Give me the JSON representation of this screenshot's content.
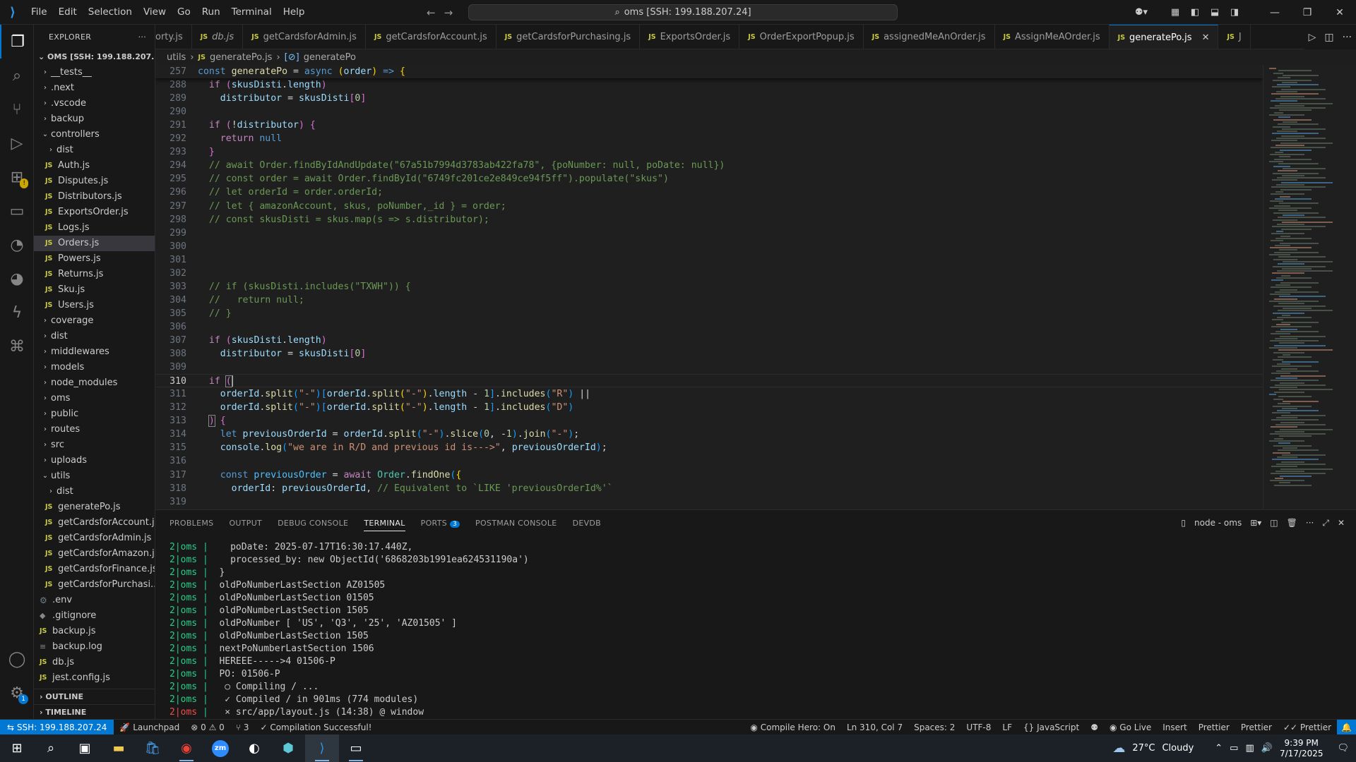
{
  "titlebar": {
    "menu": [
      "File",
      "Edit",
      "Selection",
      "View",
      "Go",
      "Run",
      "Terminal",
      "Help"
    ],
    "search_text": "oms [SSH: 199.188.207.24]"
  },
  "activity_bar": {
    "items": [
      "explorer-icon",
      "search-icon",
      "source-control-icon",
      "run-debug-icon",
      "extensions-icon",
      "remote-explorer-icon",
      "git-graph-icon",
      "thunder-client-icon",
      "lightning-icon",
      "python-icon"
    ],
    "bottom": [
      "account-icon",
      "settings-icon"
    ],
    "settings_badge": "1"
  },
  "explorer": {
    "title": "EXPLORER",
    "root": "OMS [SSH: 199.188.207.24]",
    "items": [
      {
        "label": "__tests__",
        "type": "folder",
        "depth": 1,
        "open": false
      },
      {
        "label": ".next",
        "type": "folder",
        "depth": 1,
        "open": false
      },
      {
        "label": ".vscode",
        "type": "folder",
        "depth": 1,
        "open": false
      },
      {
        "label": "backup",
        "type": "folder",
        "depth": 1,
        "open": false
      },
      {
        "label": "controllers",
        "type": "folder",
        "depth": 1,
        "open": true
      },
      {
        "label": "dist",
        "type": "folder",
        "depth": 2,
        "open": false
      },
      {
        "label": "Auth.js",
        "type": "js",
        "depth": 2
      },
      {
        "label": "Disputes.js",
        "type": "js",
        "depth": 2
      },
      {
        "label": "Distributors.js",
        "type": "js",
        "depth": 2
      },
      {
        "label": "ExportsOrder.js",
        "type": "js",
        "depth": 2
      },
      {
        "label": "Logs.js",
        "type": "js",
        "depth": 2
      },
      {
        "label": "Orders.js",
        "type": "js",
        "depth": 2,
        "selected": true
      },
      {
        "label": "Powers.js",
        "type": "js",
        "depth": 2
      },
      {
        "label": "Returns.js",
        "type": "js",
        "depth": 2
      },
      {
        "label": "Sku.js",
        "type": "js",
        "depth": 2
      },
      {
        "label": "Users.js",
        "type": "js",
        "depth": 2
      },
      {
        "label": "coverage",
        "type": "folder",
        "depth": 1,
        "open": false
      },
      {
        "label": "dist",
        "type": "folder",
        "depth": 1,
        "open": false
      },
      {
        "label": "middlewares",
        "type": "folder",
        "depth": 1,
        "open": false
      },
      {
        "label": "models",
        "type": "folder",
        "depth": 1,
        "open": false
      },
      {
        "label": "node_modules",
        "type": "folder",
        "depth": 1,
        "open": false
      },
      {
        "label": "oms",
        "type": "folder",
        "depth": 1,
        "open": false
      },
      {
        "label": "public",
        "type": "folder",
        "depth": 1,
        "open": false
      },
      {
        "label": "routes",
        "type": "folder",
        "depth": 1,
        "open": false
      },
      {
        "label": "src",
        "type": "folder",
        "depth": 1,
        "open": false
      },
      {
        "label": "uploads",
        "type": "folder",
        "depth": 1,
        "open": false
      },
      {
        "label": "utils",
        "type": "folder",
        "depth": 1,
        "open": true
      },
      {
        "label": "dist",
        "type": "folder",
        "depth": 2,
        "open": false
      },
      {
        "label": "generatePo.js",
        "type": "js",
        "depth": 2
      },
      {
        "label": "getCardsforAccount.js",
        "type": "js",
        "depth": 2
      },
      {
        "label": "getCardsforAdmin.js",
        "type": "js",
        "depth": 2
      },
      {
        "label": "getCardsforAmazon.js",
        "type": "js",
        "depth": 2
      },
      {
        "label": "getCardsforFinance.js",
        "type": "js",
        "depth": 2
      },
      {
        "label": "getCardsforPurchasi...",
        "type": "js",
        "depth": 2
      },
      {
        "label": ".env",
        "type": "gear",
        "depth": 1
      },
      {
        "label": ".gitignore",
        "type": "plain",
        "depth": 1
      },
      {
        "label": "backup.js",
        "type": "js",
        "depth": 1
      },
      {
        "label": "backup.log",
        "type": "log",
        "depth": 1
      },
      {
        "label": "db.js",
        "type": "js",
        "depth": 1
      },
      {
        "label": "jest.config.js",
        "type": "js",
        "depth": 1
      }
    ],
    "outline": "OUTLINE",
    "timeline": "TIMELINE"
  },
  "tabs": [
    {
      "label": "orty.js",
      "js": false
    },
    {
      "label": "db.js",
      "js": true,
      "italic": true
    },
    {
      "label": "getCardsforAdmin.js",
      "js": true
    },
    {
      "label": "getCardsforAccount.js",
      "js": true
    },
    {
      "label": "getCardsforPurchasing.js",
      "js": true
    },
    {
      "label": "ExportsOrder.js",
      "js": true
    },
    {
      "label": "OrderExportPopup.js",
      "js": true
    },
    {
      "label": "assignedMeAnOrder.js",
      "js": true
    },
    {
      "label": "AssignMeAOrder.js",
      "js": true
    },
    {
      "label": "generatePo.js",
      "js": true,
      "active": true
    },
    {
      "label": "J",
      "js": true
    }
  ],
  "breadcrumb": {
    "folder": "utils",
    "file": "generatePo.js",
    "symbol": "generatePo"
  },
  "editor": {
    "cursor_line": "310",
    "lines": [
      {
        "n": "257",
        "sticky": true,
        "html": "<span class=\"kw\">const</span> <span class=\"fn\">generatePo</span> <span class=\"pl\">=</span> <span class=\"kw\">async</span> <span class=\"br1\">(</span><span class=\"vr\">order</span><span class=\"br1\">)</span> <span class=\"kw\">=&gt;</span> <span class=\"br1\">{</span>"
      },
      {
        "n": "288",
        "html": "  <span class=\"ct\">if</span> <span class=\"br2\">(</span><span class=\"vr\">skusDisti</span><span class=\"pl\">.</span><span class=\"vr\">length</span><span class=\"br2\">)</span>"
      },
      {
        "n": "289",
        "html": "    <span class=\"vr\">distributor</span> <span class=\"pl\">=</span> <span class=\"vr\">skusDisti</span><span class=\"br2\">[</span><span class=\"nm\">0</span><span class=\"br2\">]</span>"
      },
      {
        "n": "290",
        "html": ""
      },
      {
        "n": "291",
        "html": "  <span class=\"ct\">if</span> <span class=\"br2\">(</span><span class=\"pl\">!</span><span class=\"vr\">distributor</span><span class=\"br2\">)</span> <span class=\"br2\">{</span>"
      },
      {
        "n": "292",
        "html": "    <span class=\"ct\">return</span> <span class=\"kw\">null</span>"
      },
      {
        "n": "293",
        "html": "  <span class=\"br2\">}</span>"
      },
      {
        "n": "294",
        "html": "  <span class=\"cm\">// await Order.findByIdAndUpdate(\"67a51b7994d3783ab422fa78\", {poNumber: null, poDate: null})</span>"
      },
      {
        "n": "295",
        "html": "  <span class=\"cm\">// const order = await Order.findById(\"6749fc201ce2e849ce94f5ff\").populate(\"skus\")</span>"
      },
      {
        "n": "296",
        "html": "  <span class=\"cm\">// let orderId = order.orderId;</span>"
      },
      {
        "n": "297",
        "html": "  <span class=\"cm\">// let { amazonAccount, skus, poNumber,_id } = order;</span>"
      },
      {
        "n": "298",
        "html": "  <span class=\"cm\">// const skusDisti = skus.map(s =&gt; s.distributor);</span>"
      },
      {
        "n": "299",
        "html": ""
      },
      {
        "n": "300",
        "html": ""
      },
      {
        "n": "301",
        "html": ""
      },
      {
        "n": "302",
        "html": ""
      },
      {
        "n": "303",
        "html": "  <span class=\"cm\">// if (skusDisti.includes(\"TXWH\")) {</span>"
      },
      {
        "n": "304",
        "html": "  <span class=\"cm\">//   return null;</span>"
      },
      {
        "n": "305",
        "html": "  <span class=\"cm\">// }</span>"
      },
      {
        "n": "306",
        "html": ""
      },
      {
        "n": "307",
        "html": "  <span class=\"ct\">if</span> <span class=\"br2\">(</span><span class=\"vr\">skusDisti</span><span class=\"pl\">.</span><span class=\"vr\">length</span><span class=\"br2\">)</span>"
      },
      {
        "n": "308",
        "html": "    <span class=\"vr\">distributor</span> <span class=\"pl\">=</span> <span class=\"vr\">skusDisti</span><span class=\"br2\">[</span><span class=\"nm\">0</span><span class=\"br2\">]</span>"
      },
      {
        "n": "309",
        "html": ""
      },
      {
        "n": "310",
        "cur": true,
        "html": "  <span class=\"ct\">if</span> <span class=\"br2\" style=\"outline:1px solid #888\">(</span><span class=\"cursor\"></span>"
      },
      {
        "n": "311",
        "html": "    <span class=\"vr\">orderId</span><span class=\"pl\">.</span><span class=\"fn\">split</span><span class=\"br3\">(</span><span class=\"st\">\"-\"</span><span class=\"br3\">)</span><span class=\"br3\">[</span><span class=\"vr\">orderId</span><span class=\"pl\">.</span><span class=\"fn\">split</span><span class=\"br1\">(</span><span class=\"st\">\"-\"</span><span class=\"br1\">)</span><span class=\"pl\">.</span><span class=\"vr\">length</span> <span class=\"pl\">-</span> <span class=\"nm\">1</span><span class=\"br3\">]</span><span class=\"pl\">.</span><span class=\"fn\">includes</span><span class=\"br3\">(</span><span class=\"st\">\"R\"</span><span class=\"br3\">)</span> <span class=\"pl\">||</span>"
      },
      {
        "n": "312",
        "html": "    <span class=\"vr\">orderId</span><span class=\"pl\">.</span><span class=\"fn\">split</span><span class=\"br3\">(</span><span class=\"st\">\"-\"</span><span class=\"br3\">)</span><span class=\"br3\">[</span><span class=\"vr\">orderId</span><span class=\"pl\">.</span><span class=\"fn\">split</span><span class=\"br1\">(</span><span class=\"st\">\"-\"</span><span class=\"br1\">)</span><span class=\"pl\">.</span><span class=\"vr\">length</span> <span class=\"pl\">-</span> <span class=\"nm\">1</span><span class=\"br3\">]</span><span class=\"pl\">.</span><span class=\"fn\">includes</span><span class=\"br3\">(</span><span class=\"st\">\"D\"</span><span class=\"br3\">)</span>"
      },
      {
        "n": "313",
        "html": "  <span class=\"br2\" style=\"outline:1px solid #888\">)</span> <span class=\"br2\">{</span>"
      },
      {
        "n": "314",
        "html": "    <span class=\"kw\">let</span> <span class=\"vr\">previousOrderId</span> <span class=\"pl\">=</span> <span class=\"vr\">orderId</span><span class=\"pl\">.</span><span class=\"fn\">split</span><span class=\"br3\">(</span><span class=\"st\">\"-\"</span><span class=\"br3\">)</span><span class=\"pl\">.</span><span class=\"fn\">slice</span><span class=\"br3\">(</span><span class=\"nm\">0</span><span class=\"pl\">,</span> <span class=\"pl\">-</span><span class=\"nm\">1</span><span class=\"br3\">)</span><span class=\"pl\">.</span><span class=\"fn\">join</span><span class=\"br3\">(</span><span class=\"st\">\"-\"</span><span class=\"br3\">)</span><span class=\"pl\">;</span>"
      },
      {
        "n": "315",
        "html": "    <span class=\"vr\">console</span><span class=\"pl\">.</span><span class=\"fn\">log</span><span class=\"br3\">(</span><span class=\"st\">\"we are in R/D and previous id is---&gt;\"</span><span class=\"pl\">,</span> <span class=\"vr\">previousOrderId</span><span class=\"br3\">)</span><span class=\"pl\">;</span>"
      },
      {
        "n": "316",
        "html": ""
      },
      {
        "n": "317",
        "html": "    <span class=\"kw\">const</span> <span class=\"cn\">previousOrder</span> <span class=\"pl\">=</span> <span class=\"ct\">await</span> <span class=\"cls\">Order</span><span class=\"pl\">.</span><span class=\"fn\">findOne</span><span class=\"br3\">(</span><span class=\"br1\">{</span>"
      },
      {
        "n": "318",
        "html": "      <span class=\"vr\">orderId</span><span class=\"pl\">:</span> <span class=\"vr\">previousOrderId</span><span class=\"pl\">,</span> <span class=\"cm\">// Equivalent to `LIKE 'previousOrderId%'`</span>"
      },
      {
        "n": "319",
        "html": ""
      }
    ]
  },
  "panel": {
    "tabs": [
      "PROBLEMS",
      "OUTPUT",
      "DEBUG CONSOLE",
      "TERMINAL",
      "PORTS",
      "POSTMAN CONSOLE",
      "DEVDB"
    ],
    "active_tab": "TERMINAL",
    "ports_badge": "3",
    "terminal_name": "node - oms",
    "lines": [
      {
        "p": "2|oms",
        "t": "    poDate: 2025-07-17T16:30:17.440Z,"
      },
      {
        "p": "2|oms",
        "t": "    processed_by: new ObjectId('6868203b1991ea624531190a')"
      },
      {
        "p": "2|oms",
        "t": "  }"
      },
      {
        "p": "2|oms",
        "t": "  oldPoNumberLastSection AZ01505"
      },
      {
        "p": "2|oms",
        "t": "  oldPoNumberLastSection 01505"
      },
      {
        "p": "2|oms",
        "t": "  oldPoNumberLastSection 1505"
      },
      {
        "p": "2|oms",
        "t": "  oldPoNumber [ 'US', 'Q3', '25', 'AZ01505' ]"
      },
      {
        "p": "2|oms",
        "t": "  oldPoNumberLastSection 1505"
      },
      {
        "p": "2|oms",
        "t": "  nextPoNumberLastSection 1506"
      },
      {
        "p": "2|oms",
        "t": "  HEREEE----->4 01506-P"
      },
      {
        "p": "2|oms",
        "t": "  PO: 01506-P"
      },
      {
        "p": "2|oms",
        "t": "   ○ Compiling / ..."
      },
      {
        "p": "2|oms",
        "t": "   ✓ Compiled / in 901ms (774 modules)"
      },
      {
        "p": "2|oms",
        "t": "   ⨯ src/app/layout.js (14:38) @ window",
        "red": true
      }
    ]
  },
  "statusbar": {
    "remote": "SSH: 199.188.207.24",
    "launchpad": "Launchpad",
    "errors": "0",
    "warnings": "0",
    "ports": "3",
    "compile": "Compilation Successful!",
    "compile_hero": "Compile Hero: On",
    "position": "Ln 310, Col 7",
    "spaces": "Spaces: 2",
    "encoding": "UTF-8",
    "eol": "LF",
    "language": "JavaScript",
    "golive": "Go Live",
    "insert": "Insert",
    "prettier1": "Prettier",
    "prettier2": "Prettier",
    "prettier3": "Prettier"
  },
  "taskbar": {
    "apps": [
      "windows-start-icon",
      "search-icon",
      "task-view-icon",
      "file-explorer-icon",
      "store-icon",
      "chrome-icon",
      "zoom-icon",
      "app-icon",
      "app-icon-2",
      "vscode-icon",
      "terminal-icon"
    ],
    "weather_temp": "27°C",
    "weather_text": "Cloudy",
    "time": "9:39 PM",
    "date": "7/17/2025"
  }
}
